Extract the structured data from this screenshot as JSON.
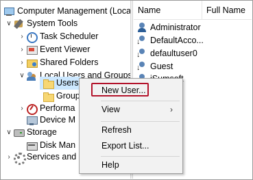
{
  "tree": {
    "root": "Computer Management (Local",
    "system_tools": "System Tools",
    "task_scheduler": "Task Scheduler",
    "event_viewer": "Event Viewer",
    "shared_folders": "Shared Folders",
    "local_users_groups": "Local Users and Groups",
    "users": "Users",
    "groups": "Group",
    "performance": "Performa",
    "device_manager": "Device M",
    "storage": "Storage",
    "disk_management": "Disk Man",
    "services_apps": "Services and"
  },
  "list": {
    "col_name": "Name",
    "col_full_name": "Full Name",
    "users": [
      "Administrator",
      "DefaultAcco...",
      "defaultuser0",
      "Guest",
      "iSumsoft"
    ]
  },
  "menu": {
    "new_user": "New User...",
    "view": "View",
    "refresh": "Refresh",
    "export_list": "Export List...",
    "help": "Help",
    "highlight_color": "#b3122a"
  }
}
